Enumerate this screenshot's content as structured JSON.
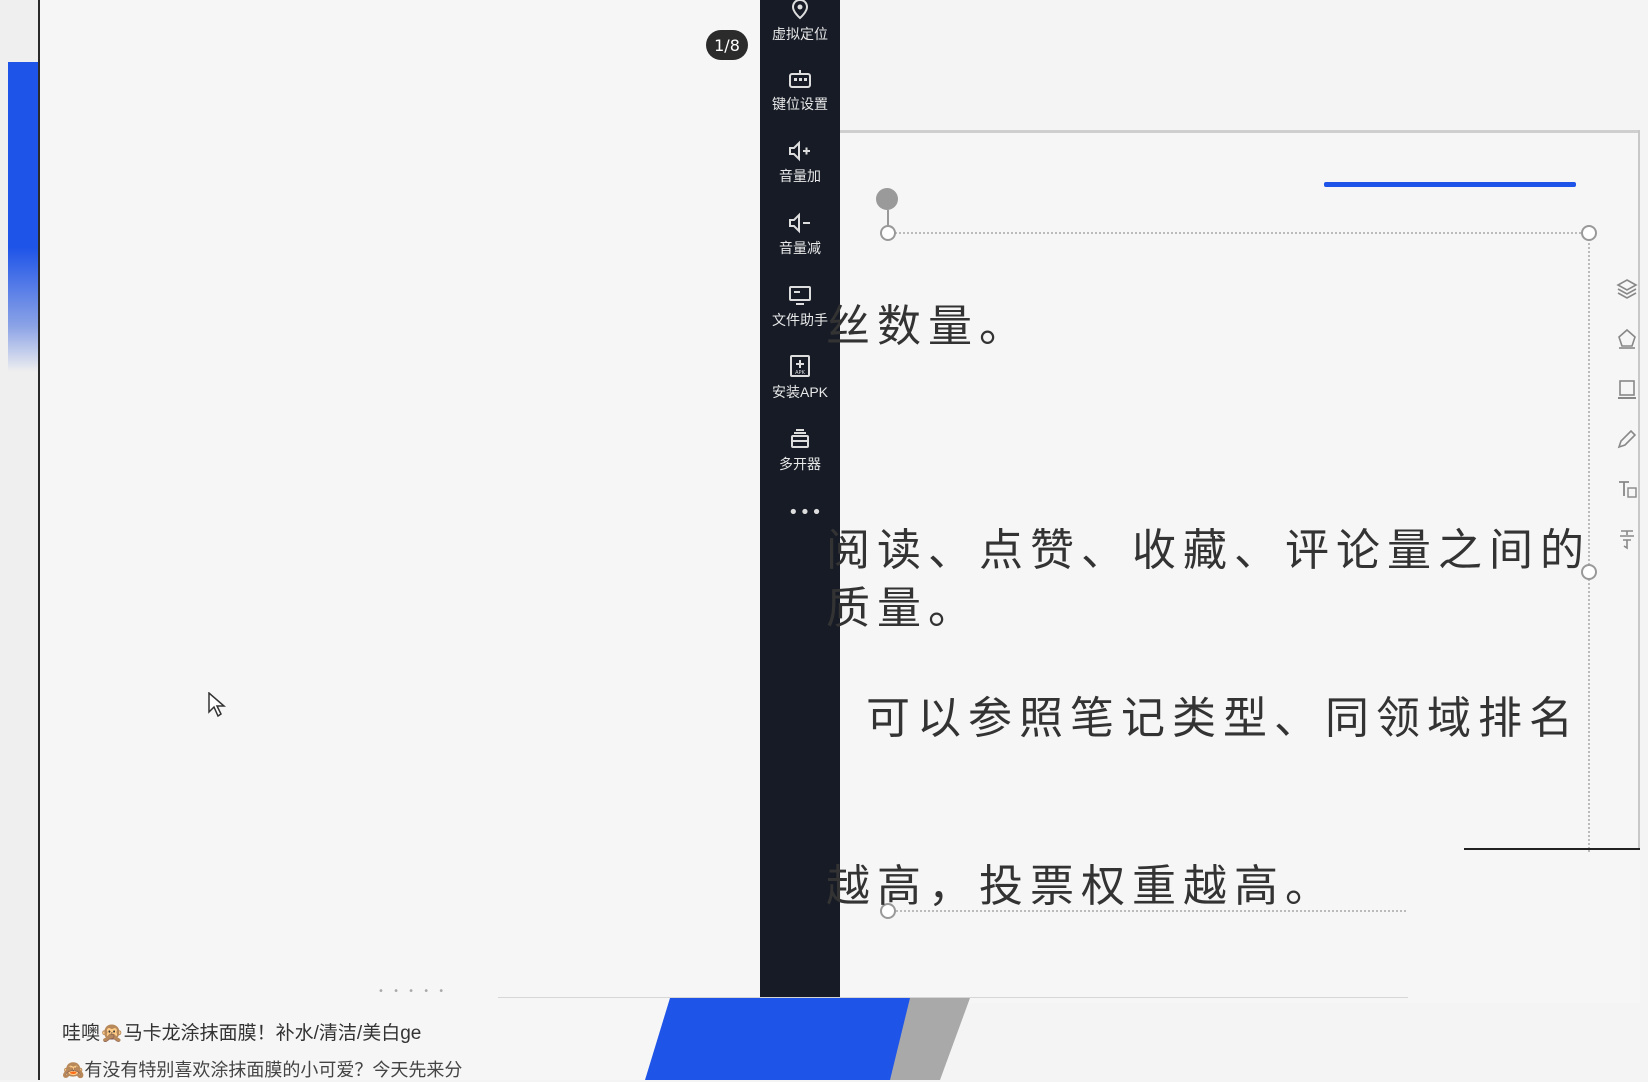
{
  "phone": {
    "page_indicator": "1/8",
    "feed": [
      "哇噢🙊马卡龙涂抹面膜！补水/清洁/美白ge",
      "🙈有没有特别喜欢涂抹面膜的小可爱？今天先来分"
    ]
  },
  "toolbar": {
    "items": [
      {
        "label": "虚拟定位",
        "icon": "location-pin-icon"
      },
      {
        "label": "键位设置",
        "icon": "keyboard-icon"
      },
      {
        "label": "音量加",
        "icon": "volume-up-icon"
      },
      {
        "label": "音量减",
        "icon": "volume-down-icon"
      },
      {
        "label": "文件助手",
        "icon": "monitor-icon"
      },
      {
        "label": "安装APK",
        "icon": "apk-install-icon"
      },
      {
        "label": "多开器",
        "icon": "multi-instance-icon"
      }
    ],
    "more": "•••"
  },
  "slide": {
    "lines": [
      "丝数量。",
      "阅读、点赞、收藏、评论量之间的",
      "质量。",
      "可以参照笔记类型、同领域排名",
      "越高，投票权重越高。"
    ]
  },
  "colors": {
    "accent": "#1f54e8",
    "toolbar_bg": "#161b26",
    "page_bg": "#f4f4f4"
  }
}
